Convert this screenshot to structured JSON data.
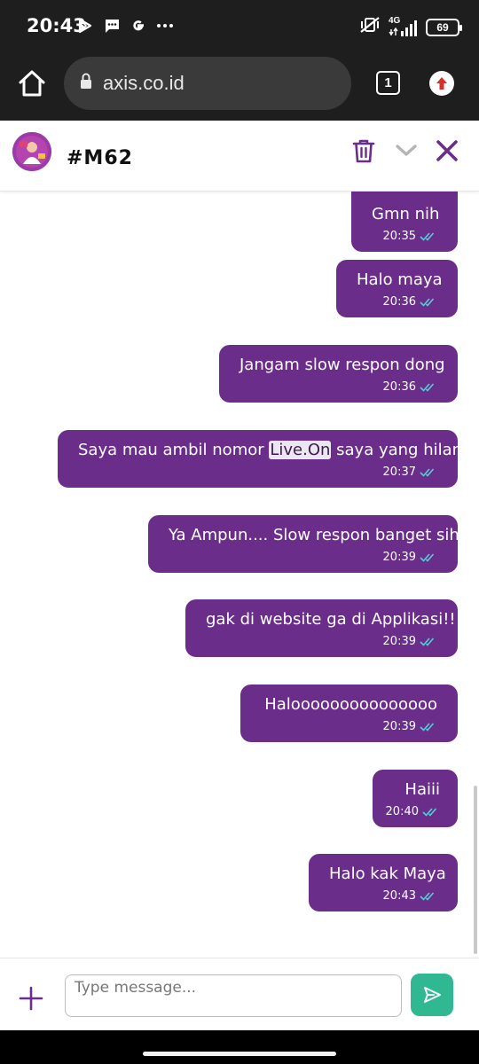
{
  "status_bar": {
    "time": "20:43",
    "icons": [
      "play-store-icon",
      "message-icon",
      "google-icon",
      "more-dots-icon"
    ],
    "network": "4G",
    "battery": "69"
  },
  "browser": {
    "url": "axis.co.id",
    "tab_count": "1"
  },
  "chat": {
    "title": "#M62",
    "accent": "#6b2d8a",
    "messages": [
      {
        "text": "Gmn nih",
        "time": "20:35"
      },
      {
        "text": "Halo maya",
        "time": "20:36"
      },
      {
        "text": "Jangam slow respon dong",
        "time": "20:36"
      },
      {
        "text_before": "Saya mau ambil nomor ",
        "highlight": "Live.On",
        "text_after": " saya yang hilang",
        "time": "20:37"
      },
      {
        "text": "Ya Ampun.... Slow respon banget sih",
        "time": "20:39"
      },
      {
        "text": "gak di website ga di Applikasi!!!",
        "time": "20:39"
      },
      {
        "text": "Halooooooooooooooo",
        "time": "20:39"
      },
      {
        "text": "Haiii",
        "time": "20:40"
      },
      {
        "text": "Halo kak Maya",
        "time": "20:43"
      }
    ]
  },
  "composer": {
    "placeholder": "Type message...",
    "value": "",
    "send_color": "#2fb892"
  }
}
